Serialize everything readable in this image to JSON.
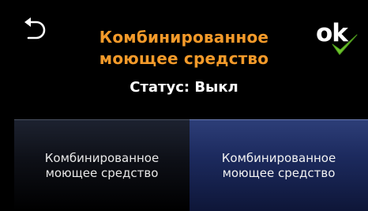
{
  "header": {
    "back_icon": "undo-arrow-icon",
    "title_line1": "Комбинированное",
    "title_line2": "моющее средство",
    "ok_label": "ok",
    "ok_check_icon": "checkmark-icon",
    "title_color": "#f39a2a",
    "check_color": "#6cc32a"
  },
  "status": {
    "text": "Статус: Выкл"
  },
  "options": [
    {
      "label": "Комбинированное моющее средство",
      "selected": false
    },
    {
      "label": "Комбинированное моющее средство",
      "selected": true
    }
  ]
}
